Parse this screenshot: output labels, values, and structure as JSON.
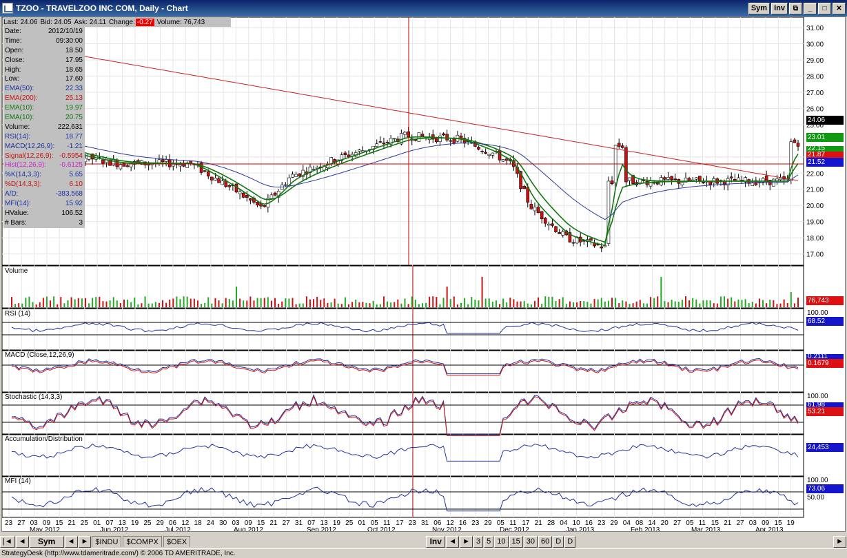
{
  "window": {
    "title": "TZOO - TRAVELZOO INC COM, Daily - Chart",
    "sym_label": "Sym",
    "inv_label": "Inv"
  },
  "quote": {
    "last": "Last: 24.06",
    "bid": "Bid: 24.05",
    "ask": "Ask: 24.11",
    "change_label": "Change:",
    "change": "-0.27",
    "volume": "Volume: 76,743"
  },
  "info": [
    {
      "label": "Date:",
      "value": "2012/10/19",
      "color": "#000000"
    },
    {
      "label": "Time:",
      "value": "09:30:00",
      "color": "#000000"
    },
    {
      "label": "Open:",
      "value": "18.50",
      "color": "#000000"
    },
    {
      "label": "Close:",
      "value": "17.95",
      "color": "#000000"
    },
    {
      "label": "High:",
      "value": "18.65",
      "color": "#000000"
    },
    {
      "label": "Low:",
      "value": "17.60",
      "color": "#000000"
    },
    {
      "label": "EMA(50):",
      "value": "22.33",
      "color": "#1e32a0"
    },
    {
      "label": "EMA(200):",
      "value": "25.13",
      "color": "#cc1111"
    },
    {
      "label": "EMA(10):",
      "value": "19.97",
      "color": "#117711"
    },
    {
      "label": "EMA(10):",
      "value": "20.75",
      "color": "#117711"
    },
    {
      "label": "Volume:",
      "value": "222,631",
      "color": "#000000"
    },
    {
      "label": "RSI(14):",
      "value": "18.77",
      "color": "#1e32a0"
    },
    {
      "label": "MACD(12,26,9):",
      "value": "-1.21",
      "color": "#1e32a0"
    },
    {
      "label": "Signal(12,26,9):",
      "value": "-0.5954",
      "color": "#cc1111"
    },
    {
      "label": "Hist(12,26,9):",
      "value": "-0.6125",
      "color": "#cc22cc"
    },
    {
      "label": "%K(14,3,3):",
      "value": "5.65",
      "color": "#1e32a0"
    },
    {
      "label": "%D(14,3,3):",
      "value": "6.10",
      "color": "#cc1111"
    },
    {
      "label": "A/D:",
      "value": "-383,568",
      "color": "#1e32a0"
    },
    {
      "label": "MFI(14):",
      "value": "15.92",
      "color": "#1e32a0"
    },
    {
      "label": "HValue:",
      "value": "106.52",
      "color": "#000000"
    },
    {
      "label": "# Bars:",
      "value": "3",
      "color": "#000000"
    }
  ],
  "panels": {
    "volume": "Volume",
    "rsi": "RSI (14)",
    "macd": "MACD (Close,12,26,9)",
    "stoch": "Stochastic (14,3,3)",
    "ad": "Accumulation/Distribution",
    "mfi": "MFI (14)"
  },
  "price_axis": [
    "31.00",
    "30.00",
    "29.00",
    "28.00",
    "27.00",
    "26.00",
    "25.00",
    "23.00",
    "22.00",
    "21.00",
    "20.00",
    "19.00",
    "18.00",
    "17.00"
  ],
  "tags": {
    "last": "24.06",
    "ema10a": "23.01",
    "ema10b": "22.15",
    "ema200": "21.87",
    "ema50": "21.52",
    "volume": "76,743",
    "rsi": "68.52",
    "macd": "0.1679",
    "macd_top": "0.2111",
    "stoch": "53.21",
    "stoch_top": "61.98",
    "ad": "24,453",
    "mfi": "73.06"
  },
  "scales": {
    "rsi_top": "100.00",
    "stoch_top": "100.00",
    "mfi_top": "100.00",
    "mfi_mid": "50.00"
  },
  "x_days": [
    "23",
    "27",
    "03",
    "09",
    "15",
    "21",
    "25",
    "01",
    "07",
    "13",
    "19",
    "25",
    "29",
    "06",
    "12",
    "18",
    "24",
    "30",
    "03",
    "09",
    "15",
    "21",
    "27",
    "31",
    "07",
    "13",
    "19",
    "25",
    "01",
    "05",
    "11",
    "17",
    "23",
    "31",
    "06",
    "12",
    "16",
    "23",
    "29",
    "05",
    "11",
    "17",
    "21",
    "28",
    "04",
    "10",
    "16",
    "23",
    "29",
    "04",
    "08",
    "14",
    "20",
    "27",
    "05",
    "11",
    "15",
    "21",
    "27",
    "03",
    "09",
    "15",
    "19"
  ],
  "x_months": [
    "May 2012",
    "Jun 2012",
    "Jul 2012",
    "Aug 2012",
    "Sep 2012",
    "Oct 2012",
    "Nov 2012",
    "Dec 2012",
    "Jan 2013",
    "Feb 2013",
    "Mar 2013",
    "Apr 2013"
  ],
  "bottom": {
    "sym": "Sym",
    "tabs": [
      "$INDU",
      "$COMPX",
      "$OEX"
    ],
    "inv": "Inv",
    "periods": [
      "3",
      "5",
      "10",
      "15",
      "30",
      "60",
      "D",
      "D"
    ]
  },
  "status": "StrategyDesk (http://www.tdameritrade.com/) © 2006 TD AMERITRADE, Inc.",
  "colors": {
    "up": "#22aa22",
    "down": "#cc1111",
    "ema50": "#2a3a9a",
    "ema200": "#cc2222",
    "ema10": "#117711"
  }
}
